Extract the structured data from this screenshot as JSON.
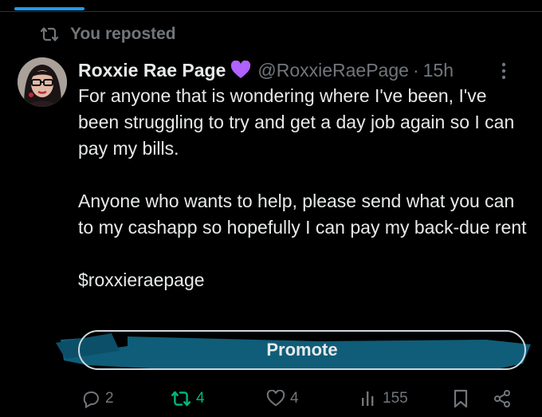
{
  "repost": {
    "label": "You reposted",
    "icon": "repost-icon"
  },
  "tweet": {
    "author_name": "Roxxie Rae Page",
    "badge_icon": "purple-heart-icon",
    "handle": "@RoxxieRaePage",
    "separator": "·",
    "time": "15h",
    "paragraphs": [
      "For anyone that is wondering where I've been, I've been struggling to try and get a day job again so I can pay my bills.",
      "Anyone who wants to help, please send what you can to my cashapp so hopefully I can pay my back-due rent",
      "$roxxieraepage"
    ]
  },
  "promote": {
    "label": "Promote"
  },
  "actions": {
    "replies": "2",
    "reposts": "4",
    "likes": "4",
    "views": "155"
  },
  "colors": {
    "background": "#000000",
    "text": "#e7e9ea",
    "muted": "#71767b",
    "accent": "#1d9bf0",
    "repost_green": "#00ba7c",
    "heart_purple": "#b061ff",
    "highlight_scribble": "#0f5d78"
  }
}
